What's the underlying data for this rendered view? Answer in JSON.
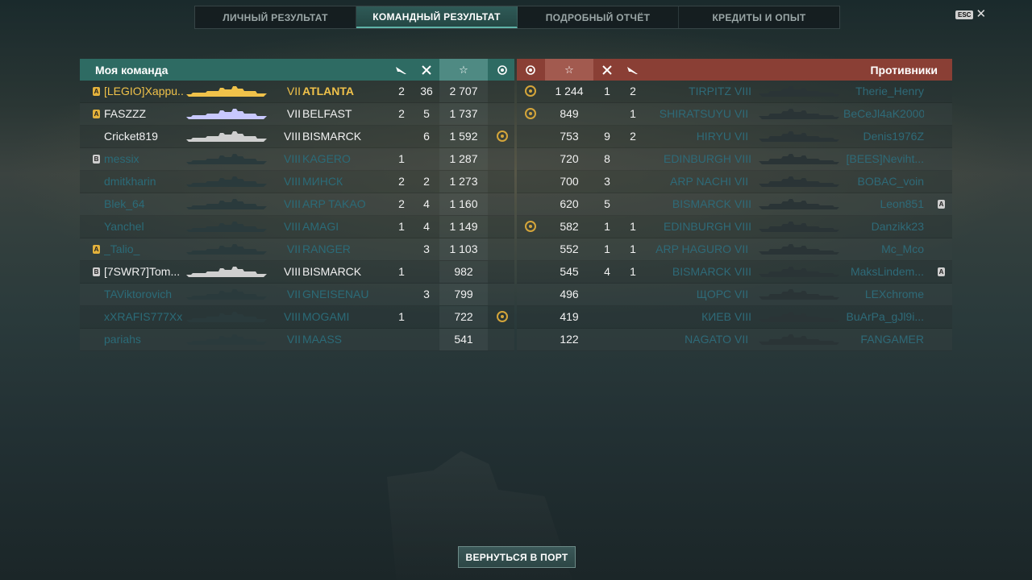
{
  "tabs": [
    {
      "label": "ЛИЧНЫЙ РЕЗУЛЬТАТ",
      "active": false
    },
    {
      "label": "КОМАНДНЫЙ РЕЗУЛЬТАТ",
      "active": true
    },
    {
      "label": "ПОДРОБНЫЙ ОТЧЁТ",
      "active": false
    },
    {
      "label": "КРЕДИТЫ И ОПЫТ",
      "active": false
    }
  ],
  "esc_label": "ESC",
  "close_glyph": "✕",
  "my_team": {
    "title": "Моя команда",
    "columns": {
      "planes_icon": "plane-icon",
      "kills_icon": "crossed-swords-icon",
      "xp_icon": "star-icon",
      "medal_icon": "medal-icon"
    },
    "rows": [
      {
        "badge": "A",
        "player": "[LEGIO]Xappu...",
        "tier": "VII",
        "ship": "ATLANTA",
        "c1": "2",
        "c2": "36",
        "xp": "2 707",
        "medal": false,
        "style": "gold"
      },
      {
        "badge": "A",
        "player": "FASZZZ",
        "tier": "VII",
        "ship": "BELFAST",
        "c1": "2",
        "c2": "5",
        "xp": "1 737",
        "medal": false,
        "style": "white"
      },
      {
        "badge": "",
        "player": "Cricket819",
        "tier": "VIII",
        "ship": "BISMARCK",
        "c1": "",
        "c2": "6",
        "xp": "1 592",
        "medal": true,
        "style": "white"
      },
      {
        "badge": "B",
        "player": "messix",
        "tier": "VIII",
        "ship": "KAGERO",
        "c1": "1",
        "c2": "",
        "xp": "1 287",
        "medal": false,
        "style": "dim"
      },
      {
        "badge": "",
        "player": "dmitkharin",
        "tier": "VIII",
        "ship": "МИНСК",
        "c1": "2",
        "c2": "2",
        "xp": "1 273",
        "medal": false,
        "style": "dim"
      },
      {
        "badge": "",
        "player": "Blek_64",
        "tier": "VIII",
        "ship": "ARP TAKAO",
        "c1": "2",
        "c2": "4",
        "xp": "1 160",
        "medal": false,
        "style": "dim"
      },
      {
        "badge": "",
        "player": "Yanchel",
        "tier": "VIII",
        "ship": "AMAGI",
        "c1": "1",
        "c2": "4",
        "xp": "1 149",
        "medal": false,
        "style": "dim"
      },
      {
        "badge": "A",
        "player": "_Talio_",
        "tier": "VII",
        "ship": "RANGER",
        "c1": "",
        "c2": "3",
        "xp": "1 103",
        "medal": false,
        "style": "dim"
      },
      {
        "badge": "B",
        "player": "[7SWR7]Tom...",
        "tier": "VIII",
        "ship": "BISMARCK",
        "c1": "1",
        "c2": "",
        "xp": "982",
        "medal": false,
        "style": "white"
      },
      {
        "badge": "",
        "player": "TAViktorovich",
        "tier": "VII",
        "ship": "GNEISENAU",
        "c1": "",
        "c2": "3",
        "xp": "799",
        "medal": false,
        "style": "dim"
      },
      {
        "badge": "",
        "player": "xXRAFIS777Xx",
        "tier": "VIII",
        "ship": "MOGAMI",
        "c1": "1",
        "c2": "",
        "xp": "722",
        "medal": true,
        "style": "dim"
      },
      {
        "badge": "",
        "player": "pariahs",
        "tier": "VII",
        "ship": "MAASS",
        "c1": "",
        "c2": "",
        "xp": "541",
        "medal": false,
        "style": "dim"
      }
    ]
  },
  "enemy_team": {
    "title": "Противники",
    "rows": [
      {
        "medal": true,
        "xp": "1 244",
        "c1": "1",
        "c2": "2",
        "ship": "TIRPITZ",
        "tier": "VIII",
        "player": "Therie_Henry",
        "badge": "",
        "style": "dim"
      },
      {
        "medal": true,
        "xp": "849",
        "c1": "",
        "c2": "1",
        "ship": "SHIRATSUYU",
        "tier": "VII",
        "player": "BeCeJl4aK2000",
        "badge": "",
        "style": "dim"
      },
      {
        "medal": false,
        "xp": "753",
        "c1": "9",
        "c2": "2",
        "ship": "HIRYU",
        "tier": "VII",
        "player": "Denis1976Z",
        "badge": "",
        "style": "dim"
      },
      {
        "medal": false,
        "xp": "720",
        "c1": "8",
        "c2": "",
        "ship": "EDINBURGH",
        "tier": "VIII",
        "player": "[BEES]Neviht...",
        "badge": "",
        "style": "dim"
      },
      {
        "medal": false,
        "xp": "700",
        "c1": "3",
        "c2": "",
        "ship": "ARP NACHI",
        "tier": "VII",
        "player": "BOBAC_voin",
        "badge": "",
        "style": "dim"
      },
      {
        "medal": false,
        "xp": "620",
        "c1": "5",
        "c2": "",
        "ship": "BISMARCK",
        "tier": "VIII",
        "player": "Leon851",
        "badge": "A",
        "style": "dim"
      },
      {
        "medal": true,
        "xp": "582",
        "c1": "1",
        "c2": "1",
        "ship": "EDINBURGH",
        "tier": "VIII",
        "player": "Danzikk23",
        "badge": "",
        "style": "dim"
      },
      {
        "medal": false,
        "xp": "552",
        "c1": "1",
        "c2": "1",
        "ship": "ARP HAGURO",
        "tier": "VII",
        "player": "Mc_Mco",
        "badge": "",
        "style": "dim"
      },
      {
        "medal": false,
        "xp": "545",
        "c1": "4",
        "c2": "1",
        "ship": "BISMARCK",
        "tier": "VIII",
        "player": "MaksLindem...",
        "badge": "A",
        "style": "dim"
      },
      {
        "medal": false,
        "xp": "496",
        "c1": "",
        "c2": "",
        "ship": "ЩОРС",
        "tier": "VII",
        "player": "LEXchrome",
        "badge": "",
        "style": "dim"
      },
      {
        "medal": false,
        "xp": "419",
        "c1": "",
        "c2": "",
        "ship": "КИЕВ",
        "tier": "VIII",
        "player": "BuArPa_gJl9i...",
        "badge": "",
        "style": "dim"
      },
      {
        "medal": false,
        "xp": "122",
        "c1": "",
        "c2": "",
        "ship": "NAGATO",
        "tier": "VII",
        "player": "FANGAMER",
        "badge": "",
        "style": "dim"
      }
    ]
  },
  "return_button": "ВЕРНУТЬСЯ В ПОРТ",
  "colors": {
    "my_header": "#2e6b63",
    "enemy_header": "#8a3f35",
    "gold": "#f0c24a",
    "dim_text": "#2b6b78"
  }
}
